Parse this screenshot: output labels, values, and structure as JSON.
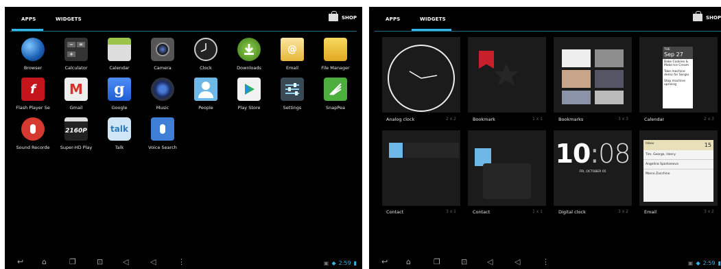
{
  "left_screen": {
    "tabs": [
      "APPS",
      "WIDGETS"
    ],
    "shop_label": "SHOP",
    "apps": [
      {
        "label": "Browser",
        "icon": "globe-icon"
      },
      {
        "label": "Calculator",
        "icon": "calculator-icon"
      },
      {
        "label": "Calendar",
        "icon": "calendar-icon"
      },
      {
        "label": "Camera",
        "icon": "camera-icon"
      },
      {
        "label": "Clock",
        "icon": "clock-icon"
      },
      {
        "label": "Downloads",
        "icon": "download-icon"
      },
      {
        "label": "Email",
        "icon": "envelope-icon"
      },
      {
        "label": "File Manager",
        "icon": "folder-icon"
      },
      {
        "label": "Flash Player Se",
        "icon": "flash-icon"
      },
      {
        "label": "Gmail",
        "icon": "gmail-icon"
      },
      {
        "label": "Google",
        "icon": "google-icon"
      },
      {
        "label": "Music",
        "icon": "speaker-icon"
      },
      {
        "label": "People",
        "icon": "people-icon"
      },
      {
        "label": "Play Store",
        "icon": "play-store-icon"
      },
      {
        "label": "Settings",
        "icon": "settings-icon"
      },
      {
        "label": "SnapPea",
        "icon": "snappea-icon"
      },
      {
        "label": "Sound Recorde",
        "icon": "microphone-icon"
      },
      {
        "label": "Super-HD Play",
        "icon": "clapper-icon"
      },
      {
        "label": "Talk",
        "icon": "talk-icon"
      },
      {
        "label": "Voice Search",
        "icon": "voice-search-icon"
      }
    ],
    "talk_text": "talk",
    "hd_text": "2160P",
    "google_glyph": "g",
    "time": "2:59"
  },
  "right_screen": {
    "tabs": [
      "APPS",
      "WIDGETS"
    ],
    "shop_label": "SHOP",
    "widgets": [
      {
        "label": "Analog clock",
        "size": "2 x 2"
      },
      {
        "label": "Bookmark",
        "size": "1 x 1"
      },
      {
        "label": "Bookmarks",
        "size": "3 x 3"
      },
      {
        "label": "Calendar",
        "size": "2 x 3"
      },
      {
        "label": "Contact",
        "size": "3 x 1"
      },
      {
        "label": "Contact",
        "size": "1 x 1"
      },
      {
        "label": "Digital clock",
        "size": "3 x 2"
      },
      {
        "label": "Email",
        "size": "3 x 2"
      }
    ],
    "calendar_preview": {
      "day": "TUE",
      "date": "Sep 27",
      "events": [
        "Bake Cookies & Make Ice Cream",
        "Take machine demo for Sergio",
        "Stop machine uprising"
      ]
    },
    "digital_clock": {
      "hour": "10",
      "minute": "08",
      "date": "FRI, OCTOBER 05"
    },
    "email_preview": {
      "title": "Inbox",
      "count": "15",
      "senders": [
        "Tim, George, Henry",
        "Angelina Sparkanova",
        "Marco Zacchino"
      ]
    },
    "time": "2:59"
  },
  "colors": {
    "accent": "#33b5e5",
    "background": "#000000"
  }
}
